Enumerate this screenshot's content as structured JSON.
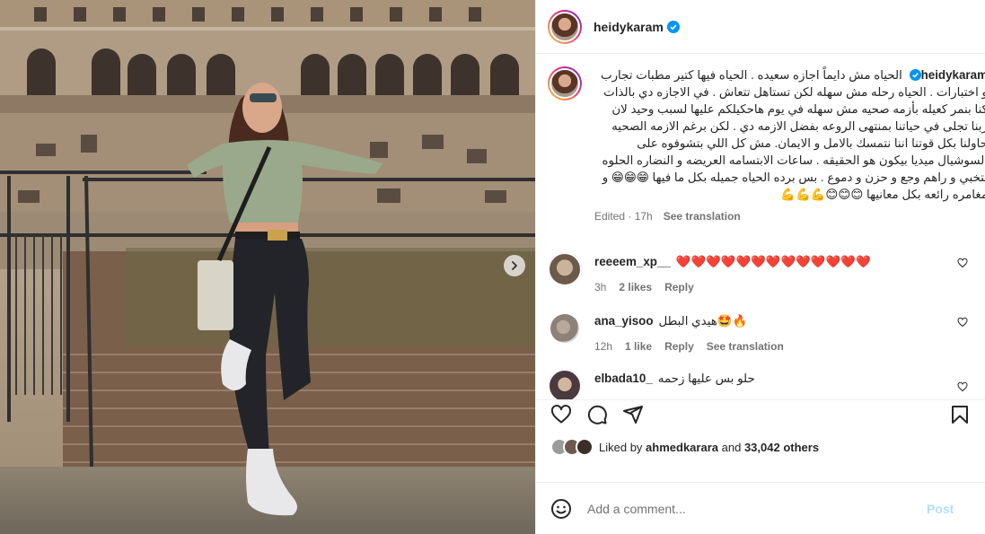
{
  "post": {
    "username": "heidykaram",
    "verified": true,
    "caption": "الحياه مش دايماً اجازه سعيده . الحياه فيها كتير مطبات تجارب و اختبارات . الحياه رحله مش سهله لكن تستاهل تتعاش . في الاجازه دي بالذات كنا بنمر كعيله بأزمه صحيه مش سهله في يوم هاحكيلكم عليها لسبب وحيد لان ربنا تجلى في حياتنا بمنتهى الروعه بفضل الازمه دي . لكن برغم الازمه الصحيه حاولنا بكل قوتنا اننا نتمسك بالامل و الايمان. مش كل اللي بتشوفوه على السوشيال ميديا بيكون هو الحقيقه . ساعات الابتسامه العريضه و النضاره الحلوه بتخبي و راهم وجع و حزن و دموع . بس برده الحياه جميله بكل ما فيها 😁😁😁 و مغامره رائعه بكل معانيها 😊😊😊💪💪💪",
    "edited_label": "Edited",
    "time": "17h",
    "see_translation": "See translation"
  },
  "comments": [
    {
      "username": "reeeem_xp__",
      "text": "❤️❤️❤️❤️❤️❤️❤️❤️❤️❤️❤️❤️❤️",
      "time": "3h",
      "likes": "2 likes",
      "reply": "Reply",
      "avatar_color": "#c9b39c"
    },
    {
      "username": "ana_yisoo",
      "text": "هيدي البطل🤩🔥",
      "time": "12h",
      "likes": "1 like",
      "reply": "Reply",
      "see_translation": "See translation",
      "avatar_color": "#8d8178"
    },
    {
      "username": "elbada10_",
      "text": "حلو بس عليها زحمه",
      "avatar_color": "#4a3a3f"
    }
  ],
  "likes": {
    "liked_by_label": "Liked by",
    "user": "ahmedkarara",
    "and_label": "and",
    "count": "33,042 others"
  },
  "add_comment": {
    "placeholder": "Add a comment...",
    "post_label": "Post"
  },
  "icons": {
    "verified": "verified-badge-icon",
    "like": "heart-icon",
    "comment": "comment-icon",
    "share": "share-icon",
    "save": "bookmark-icon",
    "emoji": "emoji-icon",
    "next": "chevron-right-icon"
  },
  "colors": {
    "verified_blue": "#0095f6",
    "muted_text": "#737373",
    "post_disabled": "#b2dffc",
    "heart_red": "#e0245e"
  }
}
